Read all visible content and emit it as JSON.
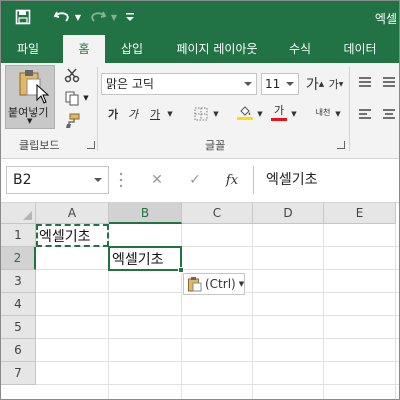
{
  "window": {
    "title": "엑셀"
  },
  "tabs": [
    "파일",
    "홈",
    "삽입",
    "페이지 레이아웃",
    "수식",
    "데이터"
  ],
  "ribbon": {
    "paste_label": "붙여넣기",
    "clipboard_group": "클립보드",
    "font_group": "글꼴",
    "font_name": "맑은 고딕",
    "font_size": "11",
    "grow_font": "가",
    "shrink_font": "가",
    "bold": "가",
    "italic": "가",
    "underline": "가",
    "font_color": "가",
    "phonetic": "내천"
  },
  "formula_bar": {
    "name_box": "B2",
    "fx": "fx",
    "value": "엑셀기초"
  },
  "grid": {
    "columns": [
      "A",
      "B",
      "C",
      "D",
      "E"
    ],
    "rows": [
      "1",
      "2",
      "3",
      "4",
      "5",
      "6",
      "7"
    ],
    "selected_cell": "B2",
    "cells": {
      "A1": "엑셀기초",
      "B2": "엑셀기초"
    }
  },
  "paste_options": {
    "label": "(Ctrl)"
  },
  "colors": {
    "accent": "#217346",
    "font_red": "#e81123",
    "fill_yellow": "#ffde00"
  }
}
